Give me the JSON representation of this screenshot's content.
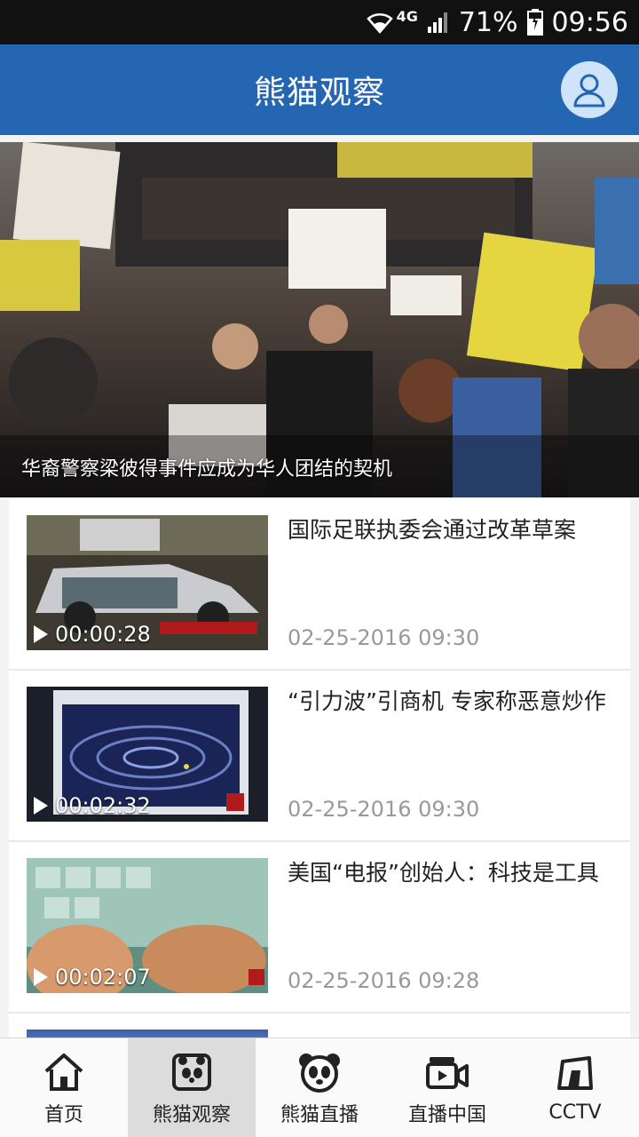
{
  "status_bar": {
    "network": "4G",
    "battery": "71%",
    "time": "09:56"
  },
  "header": {
    "title": "熊猫观察"
  },
  "banner": {
    "caption": "华裔警察梁彼得事件应成为华人团结的契机"
  },
  "news": [
    {
      "title": "国际足联执委会通过改革草案",
      "date": "02-25-2016 09:30",
      "duration": "00:00:28"
    },
    {
      "title": "“引力波”引商机 专家称恶意炒作",
      "date": "02-25-2016 09:30",
      "duration": "00:02:32"
    },
    {
      "title": "美国“电报”创始人：科技是工具",
      "date": "02-25-2016 09:28",
      "duration": "00:02:07"
    }
  ],
  "bottom_nav": [
    {
      "label": "首页",
      "icon": "home-icon"
    },
    {
      "label": "熊猫观察",
      "icon": "panda-tv-icon",
      "active": true
    },
    {
      "label": "熊猫直播",
      "icon": "panda-face-icon"
    },
    {
      "label": "直播中国",
      "icon": "video-camera-icon"
    },
    {
      "label": "CCTV",
      "icon": "cctv-logo-icon"
    }
  ],
  "colors": {
    "header_bg": "#2566b3",
    "status_bg": "#111111",
    "active_tab_bg": "#dcdcdc"
  }
}
